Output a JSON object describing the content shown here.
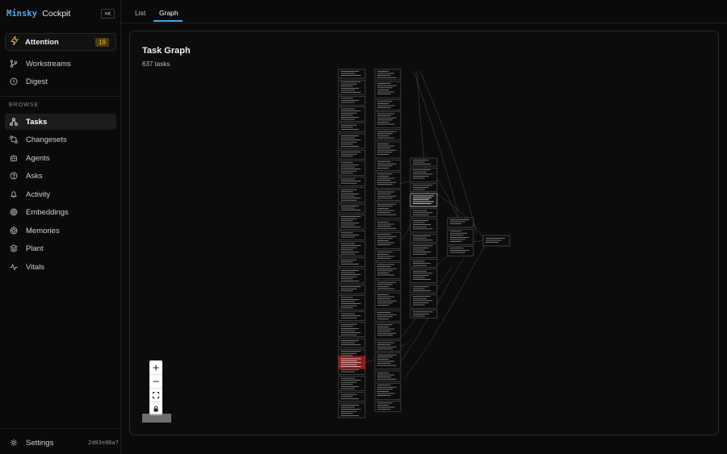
{
  "brand": {
    "name_code": "Minsky",
    "name_text": "Cockpit",
    "shortcut": "⌘K"
  },
  "attention": {
    "label": "Attention",
    "count": "19"
  },
  "nav": {
    "top": [
      {
        "label": "Workstreams",
        "icon": "branch-icon"
      },
      {
        "label": "Digest",
        "icon": "history-icon"
      }
    ],
    "section_label": "BROWSE",
    "browse": [
      {
        "label": "Tasks",
        "icon": "network-icon",
        "active": true
      },
      {
        "label": "Changesets",
        "icon": "git-compare-icon"
      },
      {
        "label": "Agents",
        "icon": "bot-icon"
      },
      {
        "label": "Asks",
        "icon": "chat-question-icon"
      },
      {
        "label": "Activity",
        "icon": "bell-icon"
      },
      {
        "label": "Embeddings",
        "icon": "chip-icon"
      },
      {
        "label": "Memories",
        "icon": "brain-icon"
      },
      {
        "label": "Plant",
        "icon": "layers-icon"
      },
      {
        "label": "Vitals",
        "icon": "pulse-icon"
      }
    ],
    "settings": {
      "label": "Settings",
      "icon": "gear-icon"
    },
    "version": "2d03e86a7"
  },
  "tabs": [
    {
      "label": "List",
      "active": false
    },
    {
      "label": "Graph",
      "active": true
    }
  ],
  "panel": {
    "title": "Task Graph",
    "subtitle": "637 tasks"
  },
  "colors": {
    "accent": "#3fa7f0",
    "attention": "#f2b233",
    "highlight_node": "#8a1c1c"
  }
}
